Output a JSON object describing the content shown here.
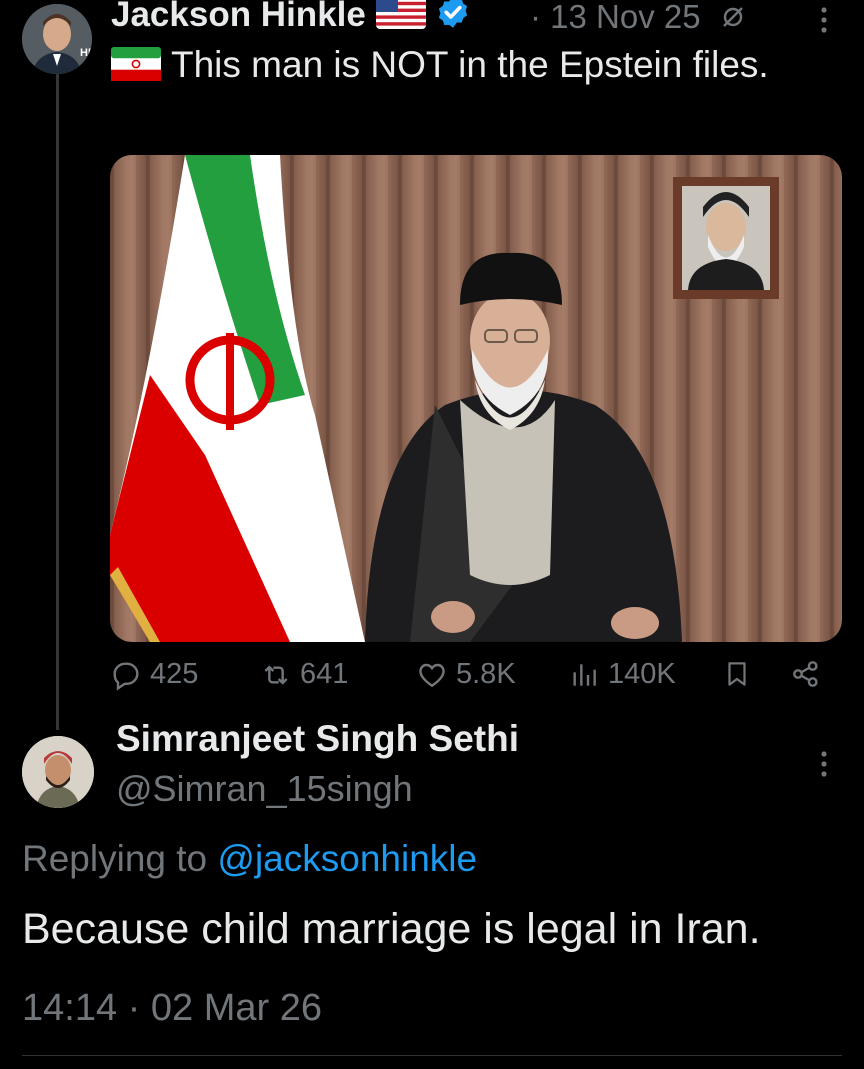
{
  "original_tweet": {
    "author_name": "Jackson Hinkle",
    "separator": "·",
    "date": "13 Nov 25",
    "text": "This man is NOT in the Epstein files.",
    "avatar_label": "HB",
    "actions": {
      "replies": "425",
      "reposts": "641",
      "likes": "5.8K",
      "views": "140K"
    }
  },
  "reply": {
    "author_name": "Simranjeet Singh Sethi",
    "handle": "@Simran_15singh",
    "replying_prefix": "Replying to",
    "replying_to": "@jacksonhinkle",
    "text": "Because child marriage is legal in Iran.",
    "timestamp": "14:14 · 02 Mar 26"
  },
  "colors": {
    "background": "#000000",
    "text_primary": "#e7e9ea",
    "text_secondary": "#71767b",
    "accent": "#1d9bf0",
    "verified": "#1d9bf0"
  }
}
